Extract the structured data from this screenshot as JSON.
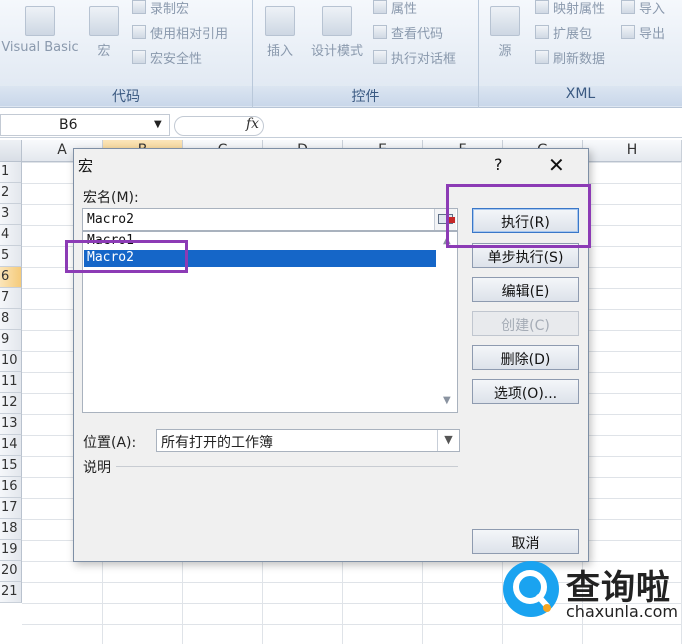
{
  "ribbon": {
    "code_group": {
      "label": "代码",
      "visual_basic": "Visual Basic",
      "macros": "宏",
      "record_macro": "录制宏",
      "relative_ref": "使用相对引用",
      "macro_security": "宏安全性"
    },
    "controls_group": {
      "label": "控件",
      "insert": "插入",
      "design_mode": "设计模式",
      "properties": "属性",
      "view_code": "查看代码",
      "run_dialog": "执行对话框"
    },
    "xml_group": {
      "label": "XML",
      "source": "源",
      "map_properties": "映射属性",
      "expansion_packs": "扩展包",
      "refresh_data": "刷新数据",
      "import": "导入",
      "export": "导出"
    }
  },
  "formula_bar": {
    "name_box": "B6",
    "fx": "fx"
  },
  "grid": {
    "columns": [
      "A",
      "B",
      "C",
      "D",
      "E",
      "F",
      "G",
      "H"
    ],
    "rows": [
      "1",
      "2",
      "3",
      "4",
      "5",
      "6",
      "7",
      "8",
      "9",
      "10",
      "11",
      "12",
      "13",
      "14",
      "15",
      "16",
      "17",
      "18",
      "19",
      "20",
      "21"
    ],
    "selected_column": "B",
    "selected_row": "6"
  },
  "dialog": {
    "title": "宏",
    "help": "?",
    "close": "✕",
    "macro_name_label": "宏名(M):",
    "macro_name_value": "Macro2",
    "macro_list": [
      "Macro1",
      "Macro2"
    ],
    "selected_macro": "Macro2",
    "buttons": {
      "run": "执行(R)",
      "step_into": "单步执行(S)",
      "edit": "编辑(E)",
      "create": "创建(C)",
      "delete": "删除(D)",
      "options": "选项(O)..."
    },
    "location_label": "位置(A):",
    "location_value": "所有打开的工作簿",
    "description_label": "说明",
    "cancel": "取消"
  },
  "watermark": {
    "cn": "查询啦",
    "en": "chaxunla.com"
  },
  "colors": {
    "highlight_box": "#8c3bb5",
    "selection": "#1566c8",
    "watermark_blue": "#1aa3f0"
  }
}
